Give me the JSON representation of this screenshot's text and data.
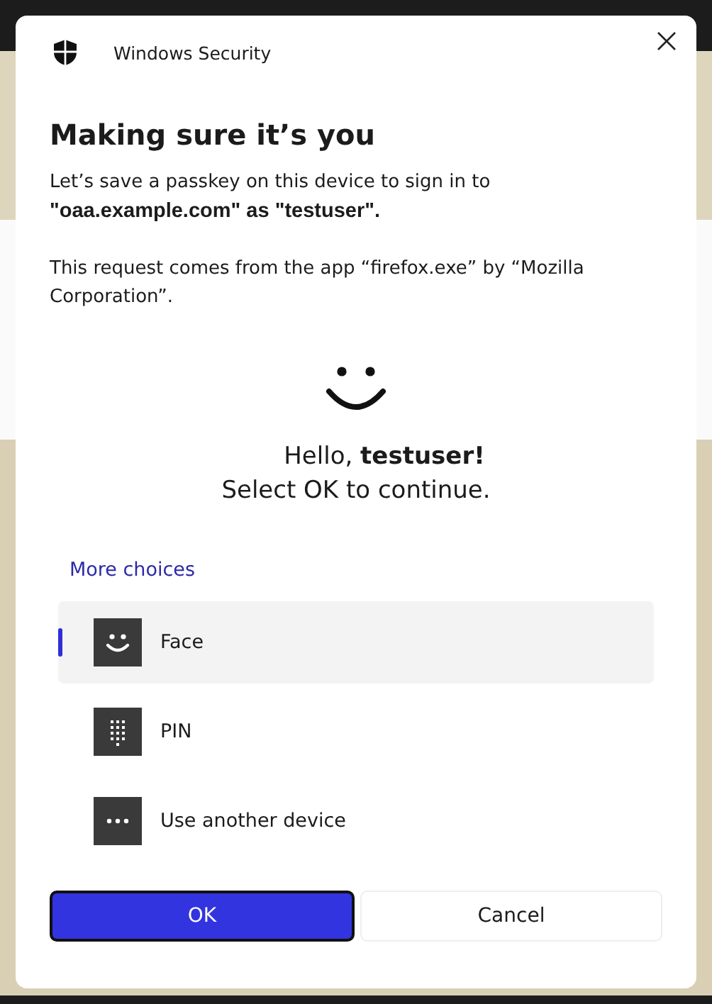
{
  "window": {
    "title": "Windows Security"
  },
  "heading": "Making sure it’s you",
  "message": "Let’s save a passkey on this device to sign in to **\"oaa.example.com\" as \"testuser\".**",
  "request_note": "This request comes from the app “firefox.exe” by “Mozilla Corporation”.",
  "greeting": "Hello, **testuser!**",
  "prompt": "Select OK to continue.",
  "more_choices": "More choices",
  "options": [
    {
      "label": "Face",
      "kind": "face",
      "selected": true
    },
    {
      "label": "PIN",
      "kind": "pin",
      "selected": false
    },
    {
      "label": "Use another device",
      "kind": "device",
      "selected": false
    }
  ],
  "buttons": [
    {
      "label": "OK",
      "kind": "primary"
    },
    {
      "label": "Cancel",
      "kind": "secondary"
    }
  ]
}
